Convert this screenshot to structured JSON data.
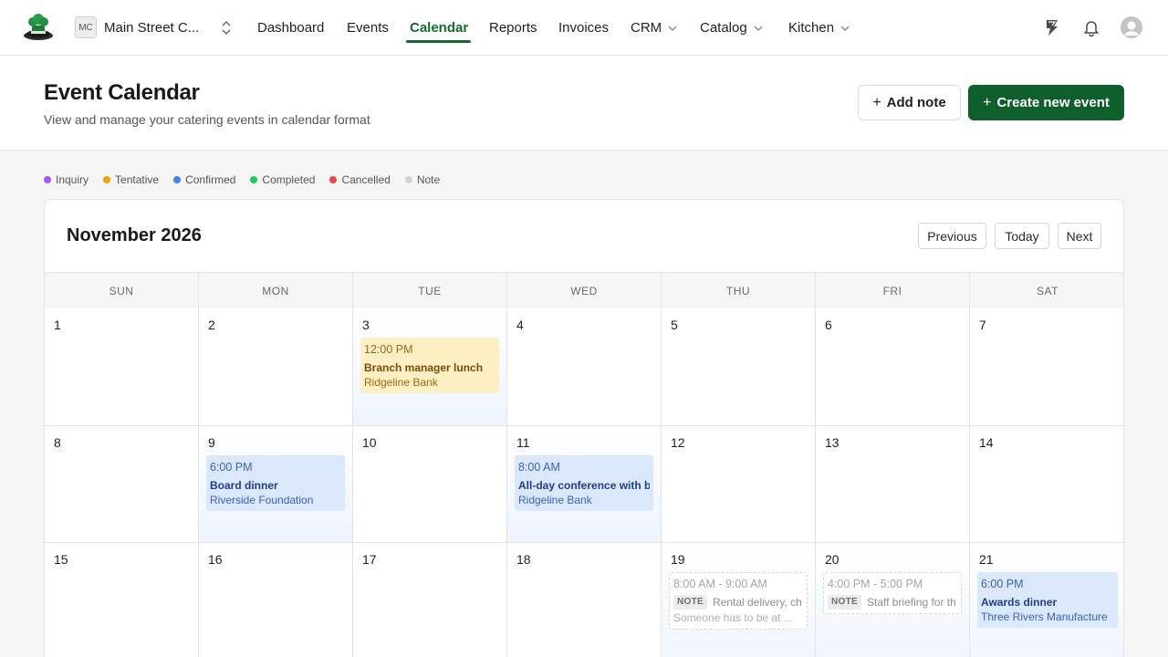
{
  "org": {
    "initials": "MC",
    "name": "Main Street C..."
  },
  "nav": {
    "items": [
      {
        "label": "Dashboard"
      },
      {
        "label": "Events"
      },
      {
        "label": "Calendar",
        "active": true
      },
      {
        "label": "Reports"
      },
      {
        "label": "Invoices"
      },
      {
        "label": "CRM",
        "dropdown": true
      },
      {
        "label": "Catalog",
        "dropdown": true
      },
      {
        "label": "Kitchen",
        "dropdown": true
      }
    ],
    "icons": [
      "feedback-icon",
      "bell-icon",
      "avatar-icon"
    ]
  },
  "header": {
    "title": "Event Calendar",
    "subtitle": "View and manage your catering events in calendar format",
    "add_note": "Add note",
    "create_event": "Create new event"
  },
  "legend": [
    {
      "label": "Inquiry",
      "color": "#a855f7"
    },
    {
      "label": "Tentative",
      "color": "#f59e0b"
    },
    {
      "label": "Confirmed",
      "color": "#3b82f6"
    },
    {
      "label": "Completed",
      "color": "#22c55e"
    },
    {
      "label": "Cancelled",
      "color": "#ef4444"
    },
    {
      "label": "Note",
      "color": "#d4d4d4"
    }
  ],
  "calendar": {
    "month_label": "November 2026",
    "prev": "Previous",
    "today": "Today",
    "next": "Next",
    "weekdays": [
      "SUN",
      "MON",
      "TUE",
      "WED",
      "THU",
      "FRI",
      "SAT"
    ],
    "weeks": [
      [
        {
          "day": "1"
        },
        {
          "day": "2"
        },
        {
          "day": "3",
          "highlight": true,
          "events": [
            {
              "kind": "tentative",
              "time": "12:00 PM",
              "name": "Branch manager lunch",
              "client": "Ridgeline Bank"
            }
          ]
        },
        {
          "day": "4"
        },
        {
          "day": "5"
        },
        {
          "day": "6"
        },
        {
          "day": "7"
        }
      ],
      [
        {
          "day": "8"
        },
        {
          "day": "9",
          "highlight": true,
          "events": [
            {
              "kind": "confirmed",
              "time": "6:00 PM",
              "name": "Board dinner",
              "client": "Riverside Foundation"
            }
          ]
        },
        {
          "day": "10"
        },
        {
          "day": "11",
          "highlight": true,
          "events": [
            {
              "kind": "confirmed",
              "time": "8:00 AM",
              "name": "All-day conference with b",
              "client": "Ridgeline Bank"
            }
          ]
        },
        {
          "day": "12"
        },
        {
          "day": "13"
        },
        {
          "day": "14"
        }
      ],
      [
        {
          "day": "15"
        },
        {
          "day": "16"
        },
        {
          "day": "17"
        },
        {
          "day": "18"
        },
        {
          "day": "19",
          "highlight": true,
          "events": [
            {
              "kind": "note",
              "time": "8:00 AM - 9:00 AM",
              "tag": "NOTE",
              "text": "Rental delivery, ch",
              "sub": "Someone has to be at ..."
            }
          ]
        },
        {
          "day": "20",
          "highlight": true,
          "events": [
            {
              "kind": "note",
              "time": "4:00 PM - 5:00 PM",
              "tag": "NOTE",
              "text": "Staff briefing for th"
            }
          ]
        },
        {
          "day": "21",
          "highlight": true,
          "events": [
            {
              "kind": "confirmed",
              "time": "6:00 PM",
              "name": "Awards dinner",
              "client": "Three Rivers Manufacture"
            }
          ]
        }
      ]
    ]
  }
}
